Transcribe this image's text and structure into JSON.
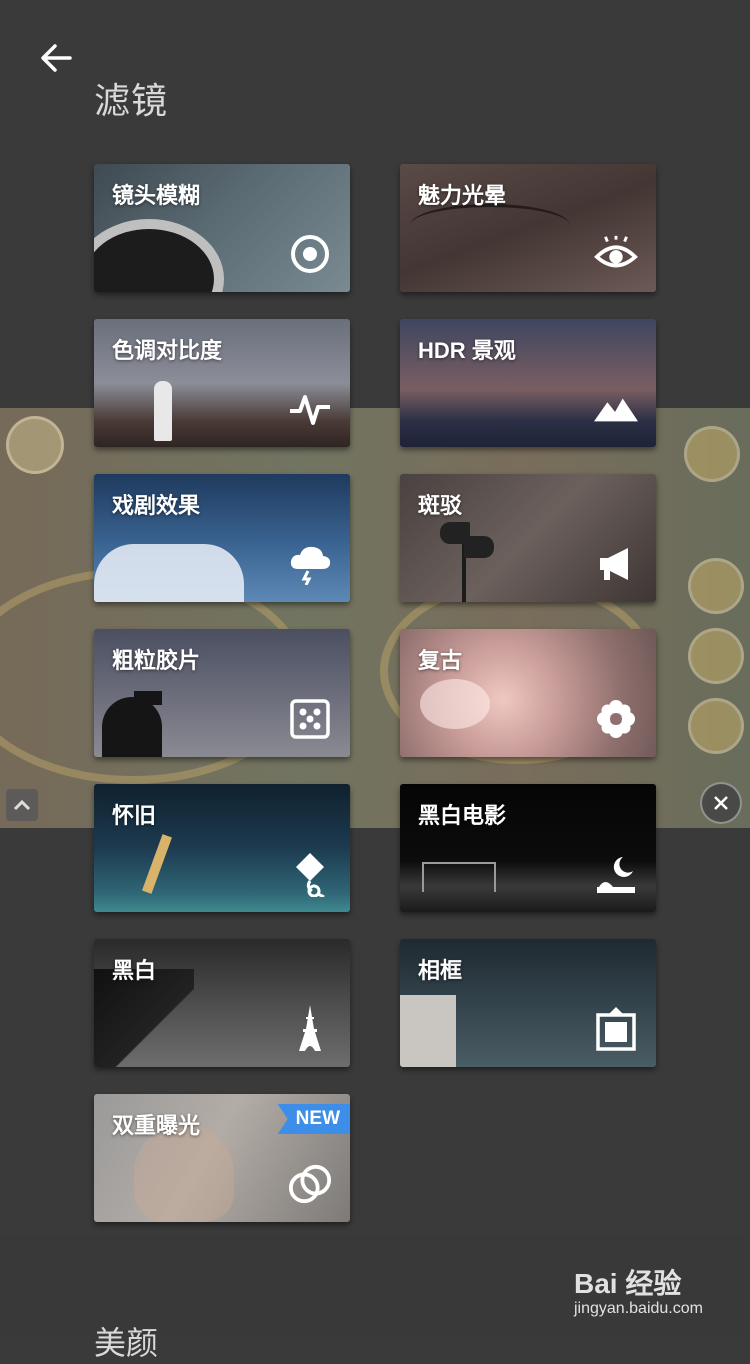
{
  "header": {
    "title": "滤镜"
  },
  "tiles": [
    {
      "label": "镜头模糊",
      "icon": "focus-target-icon"
    },
    {
      "label": "魅力光晕",
      "icon": "eye-icon"
    },
    {
      "label": "色调对比度",
      "icon": "pulse-wave-icon"
    },
    {
      "label": "HDR 景观",
      "icon": "mountains-icon"
    },
    {
      "label": "戏剧效果",
      "icon": "storm-cloud-icon"
    },
    {
      "label": "斑驳",
      "icon": "megaphone-icon"
    },
    {
      "label": "粗粒胶片",
      "icon": "dice-icon"
    },
    {
      "label": "复古",
      "icon": "flower-icon"
    },
    {
      "label": "怀旧",
      "icon": "kite-icon"
    },
    {
      "label": "黑白电影",
      "icon": "moon-over-horizon-icon"
    },
    {
      "label": "黑白",
      "icon": "eiffel-tower-icon"
    },
    {
      "label": "相框",
      "icon": "frame-icon"
    },
    {
      "label": "双重曝光",
      "icon": "double-circle-icon",
      "badge": "NEW"
    }
  ],
  "next_section": {
    "title": "美颜"
  },
  "watermark": {
    "main": "Bai 经验",
    "sub": "jingyan.baidu.com"
  },
  "colors": {
    "background": "#3a3a3a",
    "badge": "#3d8ee8",
    "text": "#ffffff"
  }
}
